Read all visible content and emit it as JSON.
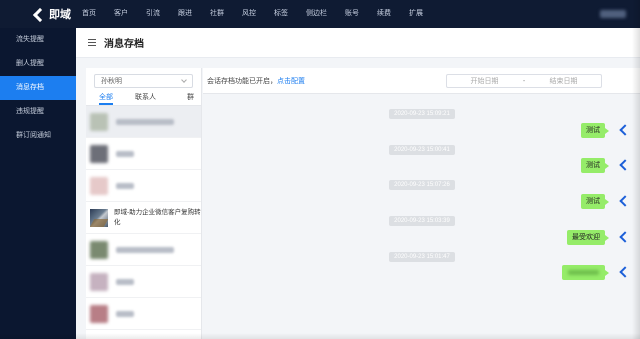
{
  "brand": {
    "name": "即域"
  },
  "nav": {
    "items": [
      "首页",
      "客户",
      "引流",
      "跟进",
      "社群",
      "风控",
      "标签",
      "侧边栏",
      "账号",
      "续费",
      "扩展"
    ]
  },
  "sidebar": {
    "items": [
      {
        "label": "流失提醒",
        "active": false
      },
      {
        "label": "删人提醒",
        "active": false
      },
      {
        "label": "消息存档",
        "active": true
      },
      {
        "label": "违规提醒",
        "active": false
      },
      {
        "label": "群订阅通知",
        "active": false
      }
    ]
  },
  "page": {
    "title": "消息存档"
  },
  "contacts": {
    "selected_account": "孙秋明",
    "tabs": [
      "全部",
      "联系人",
      "群"
    ],
    "items": [
      {
        "name": "",
        "blurred": true,
        "avatar_color": "#b9c2b5"
      },
      {
        "name": "",
        "blurred": true,
        "avatar_color": "#6d6f78"
      },
      {
        "name": "",
        "blurred": true,
        "avatar_color": "#e6c9c9"
      },
      {
        "name": "即域-助力企业微信客户复购转化",
        "blurred": false,
        "avatar_color": ""
      },
      {
        "name": "",
        "blurred": true,
        "avatar_color": "#7a8a70"
      },
      {
        "name": "",
        "blurred": true,
        "avatar_color": "#c6b2c0"
      },
      {
        "name": "",
        "blurred": true,
        "avatar_color": "#b87e86"
      }
    ]
  },
  "chat": {
    "note_prefix": "会话存档功能已开启，",
    "note_link": "点击配置",
    "date_start_placeholder": "开始日期",
    "date_separator": "-",
    "date_end_placeholder": "结束日期",
    "messages": [
      {
        "timestamp": "2020-09-23 15:09:21",
        "text": "测试",
        "blurred": false
      },
      {
        "timestamp": "2020-09-23 15:00:41",
        "text": "测试",
        "blurred": false
      },
      {
        "timestamp": "2020-09-23 15:07:26",
        "text": "测试",
        "blurred": false
      },
      {
        "timestamp": "2020-09-23 15:03:39",
        "text": "最受欢迎",
        "blurred": false
      },
      {
        "timestamp": "2020-09-23 15:01:47",
        "text": "",
        "blurred": true
      }
    ]
  },
  "colors": {
    "topbar": "#0f1b33",
    "sidebar": "#0b1730",
    "accent": "#1c7ef0",
    "bubble": "#95ec69"
  }
}
